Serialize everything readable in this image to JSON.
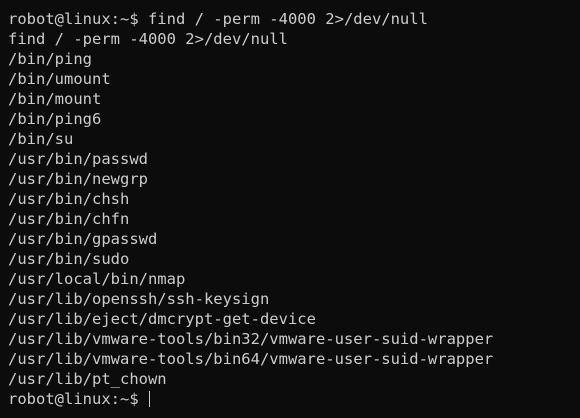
{
  "terminal": {
    "lines": [
      "robot@linux:~$ find / -perm -4000 2>/dev/null",
      "find / -perm -4000 2>/dev/null",
      "/bin/ping",
      "/bin/umount",
      "/bin/mount",
      "/bin/ping6",
      "/bin/su",
      "/usr/bin/passwd",
      "/usr/bin/newgrp",
      "/usr/bin/chsh",
      "/usr/bin/chfn",
      "/usr/bin/gpasswd",
      "/usr/bin/sudo",
      "/usr/local/bin/nmap",
      "/usr/lib/openssh/ssh-keysign",
      "/usr/lib/eject/dmcrypt-get-device",
      "/usr/lib/vmware-tools/bin32/vmware-user-suid-wrapper",
      "/usr/lib/vmware-tools/bin64/vmware-user-suid-wrapper",
      "/usr/lib/pt_chown"
    ],
    "prompt": "robot@linux:~$ "
  },
  "colors": {
    "background": "#0c0c0c",
    "text": "#cccccc"
  }
}
